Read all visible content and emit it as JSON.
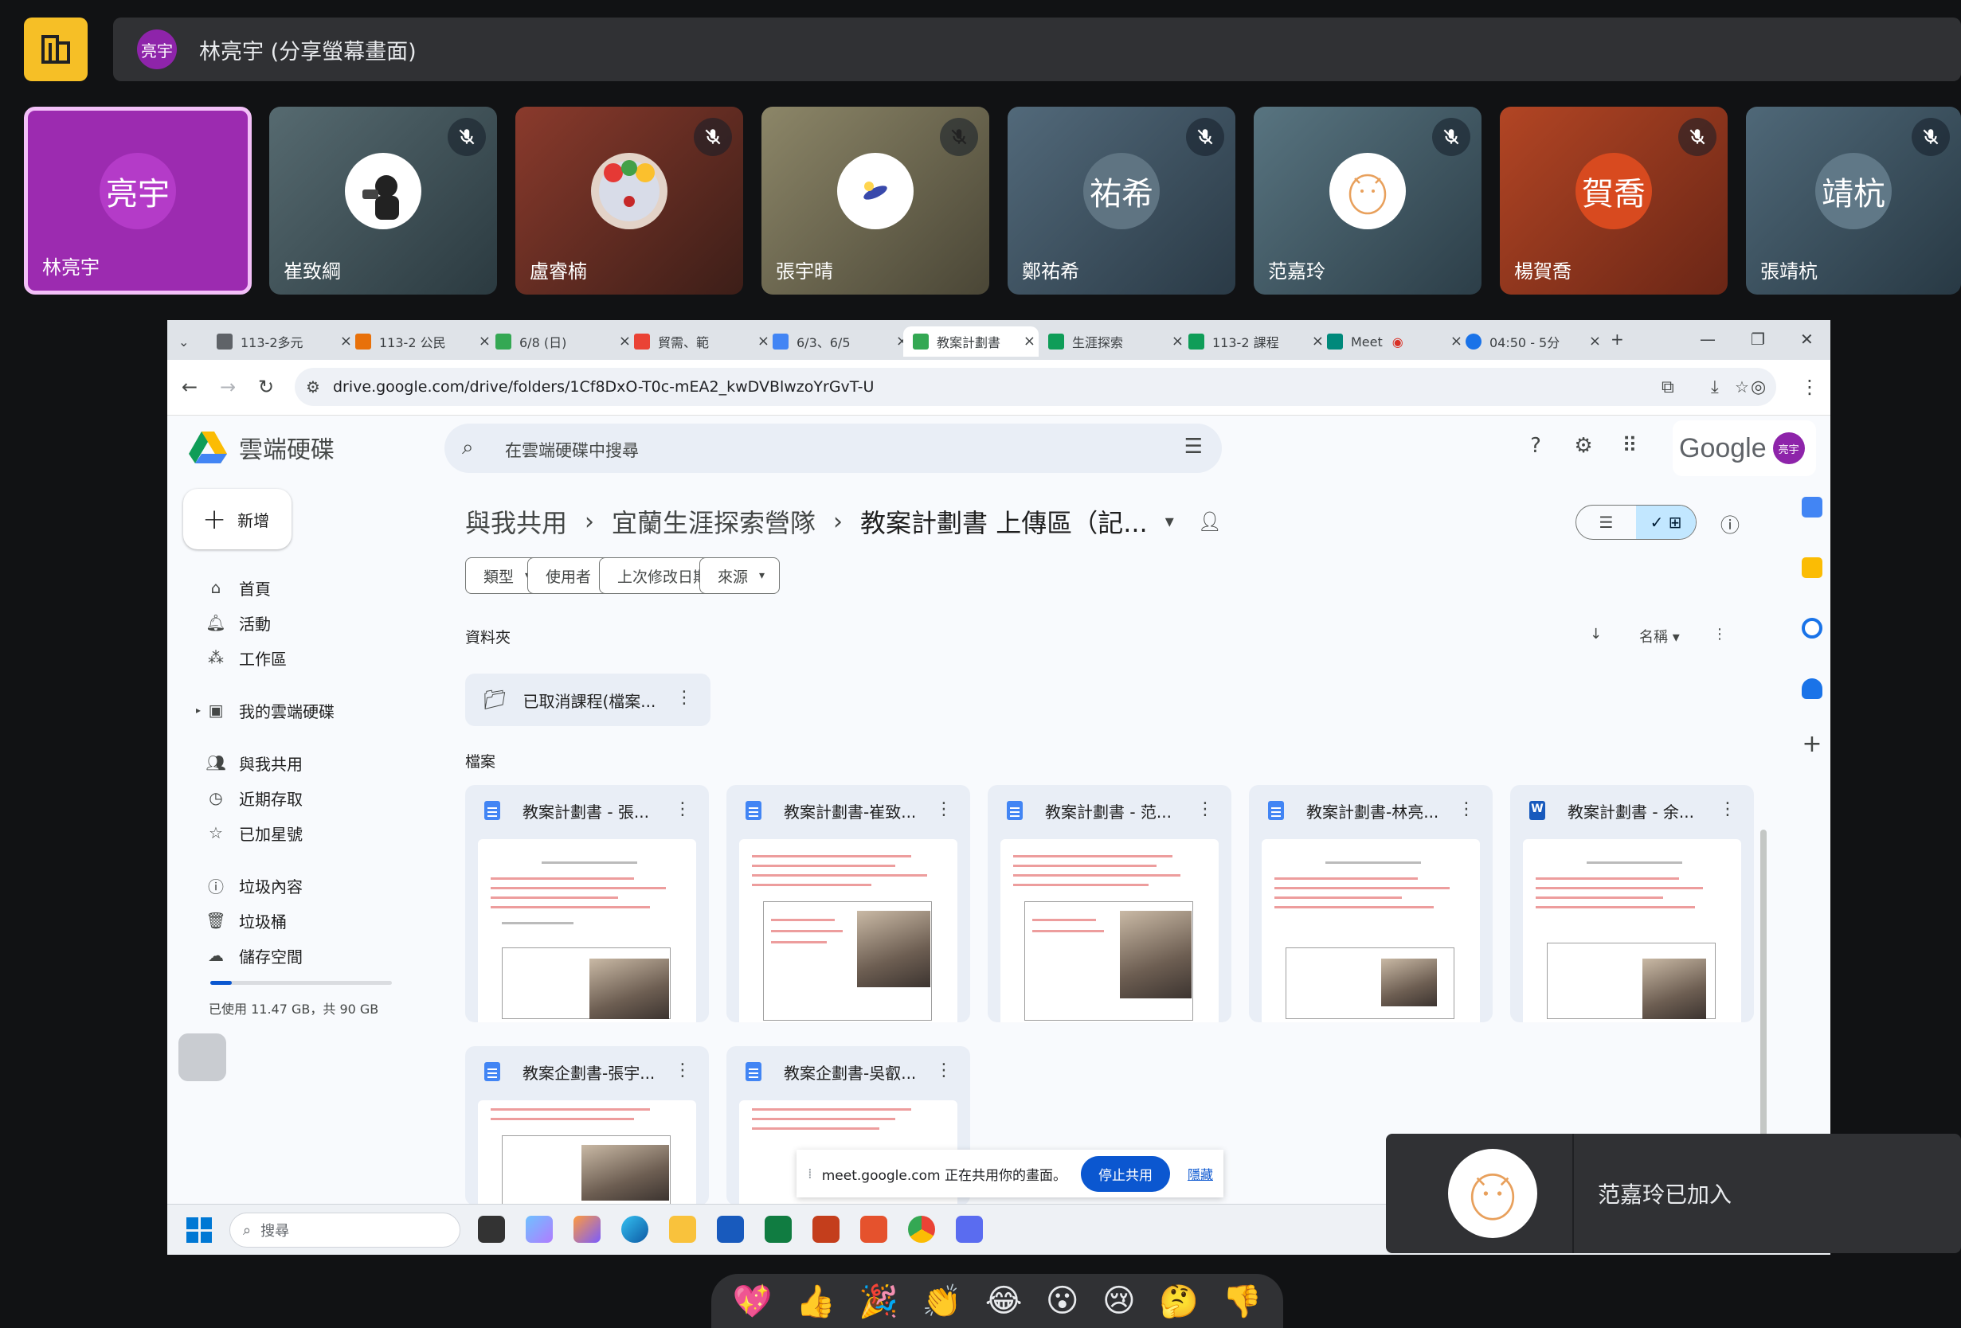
{
  "meet": {
    "presenter_initials": "亮宇",
    "presenting_title": "林亮宇 (分享螢幕畫面)"
  },
  "participants": [
    {
      "name": "林亮宇",
      "avatar_text": "亮宇",
      "muted": false,
      "active": true,
      "color": "#9c2bb0"
    },
    {
      "name": "崔致綱",
      "avatar_text": "",
      "muted": true,
      "active": false,
      "color": "#3a4a50"
    },
    {
      "name": "盧睿楠",
      "avatar_text": "",
      "muted": true,
      "active": false,
      "color": "#7a2a22"
    },
    {
      "name": "張宇晴",
      "avatar_text": "",
      "muted": true,
      "active": false,
      "color": "#6b6650"
    },
    {
      "name": "鄭祐希",
      "avatar_text": "祐希",
      "muted": true,
      "active": false,
      "color": "#3b5160"
    },
    {
      "name": "范嘉玲",
      "avatar_text": "",
      "muted": true,
      "active": false,
      "color": "#3e5764"
    },
    {
      "name": "楊賀喬",
      "avatar_text": "賀喬",
      "muted": true,
      "active": false,
      "color": "#8a3119"
    },
    {
      "name": "張靖杭",
      "avatar_text": "靖杭",
      "muted": true,
      "active": false,
      "color": "#34505e"
    }
  ],
  "browser": {
    "tabs": [
      {
        "label": "113-2多元",
        "icon_color": "#5f6368"
      },
      {
        "label": "113-2 公民",
        "icon_color": "#e8710a"
      },
      {
        "label": "6/8 (日)",
        "icon_color": "#34a853"
      },
      {
        "label": "貿需、範",
        "icon_color": "#ea4335"
      },
      {
        "label": "6/3、6/5",
        "icon_color": "#4285f4"
      },
      {
        "label": "教案計劃書",
        "icon_color": "#34a853"
      },
      {
        "label": "生涯探索",
        "icon_color": "#0f9d58"
      },
      {
        "label": "113-2 課程",
        "icon_color": "#0f9d58"
      },
      {
        "label": "Meet",
        "icon_color": "#00897b"
      },
      {
        "label": "04:50 - 5分",
        "icon_color": "#1a73e8"
      }
    ],
    "url": "drive.google.com/drive/folders/1Cf8DxO-T0c-mEA2_kwDVBlwzoYrGvT-U"
  },
  "drive": {
    "app_name": "雲端硬碟",
    "search_placeholder": "在雲端硬碟中搜尋",
    "google_word": "Google",
    "account_initials": "亮宇",
    "new_label": "新增",
    "nav": [
      "首頁",
      "活動",
      "工作區",
      "我的雲端硬碟",
      "與我共用",
      "近期存取",
      "已加星號",
      "垃圾內容",
      "垃圾桶",
      "儲存空間"
    ],
    "storage_text": "已使用 11.47 GB，共 90 GB",
    "breadcrumbs": [
      "與我共用",
      "宜蘭生涯探索營隊",
      "教案計劃書 上傳區（記..."
    ],
    "filters": [
      "類型",
      "使用者",
      "上次修改日期",
      "來源"
    ],
    "folders_label": "資料夾",
    "files_label": "檔案",
    "sort_label": "名稱",
    "folders": [
      "已取消課程(檔案..."
    ],
    "files": [
      {
        "name": "教案計劃書 - 張...",
        "type": "doc"
      },
      {
        "name": "教案計劃書-崔致...",
        "type": "doc"
      },
      {
        "name": "教案計劃書 - 范...",
        "type": "doc"
      },
      {
        "name": "教案計劃書-林亮...",
        "type": "doc"
      },
      {
        "name": "教案計劃書 - 余...",
        "type": "word"
      },
      {
        "name": "教案企劃書-張宇...",
        "type": "doc"
      },
      {
        "name": "教案企劃書-吳叡...",
        "type": "doc"
      }
    ],
    "share_notice": "meet.google.com 正在共用你的畫面。",
    "stop_share": "停止共用",
    "hide": "隱藏"
  },
  "taskbar": {
    "search_placeholder": "搜尋"
  },
  "toast": {
    "text": "范嘉玲已加入"
  },
  "reactions": [
    "💖",
    "👍",
    "🎉",
    "👏",
    "😂",
    "😮",
    "😢",
    "🤔",
    "👎"
  ]
}
